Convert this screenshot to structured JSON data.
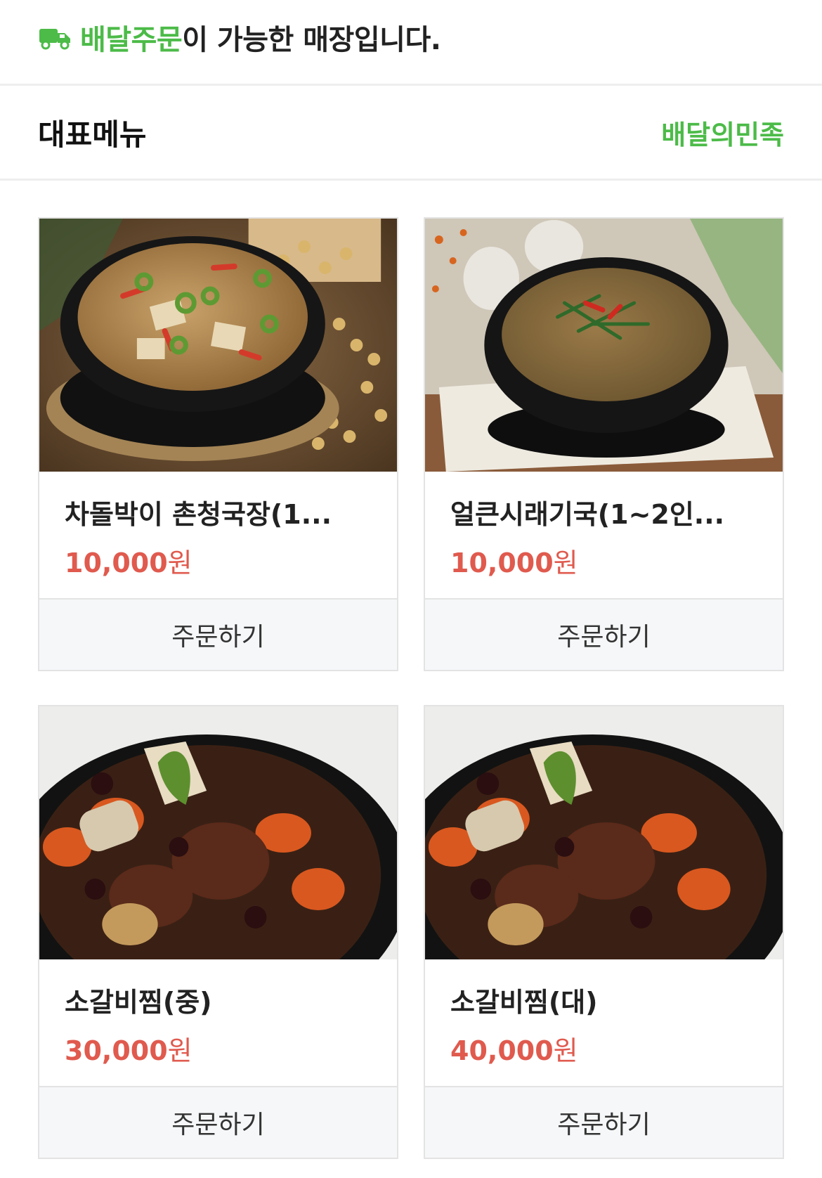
{
  "banner": {
    "highlight": "배달주문",
    "rest": "이 가능한 매장입니다.",
    "icon": "delivery-truck-icon",
    "accent": "#4cbb48"
  },
  "section": {
    "title": "대표메뉴",
    "link": "배달의민족"
  },
  "menu": {
    "order_label": "주문하기",
    "currency": "원",
    "price_color": "#e05a4e",
    "items": [
      {
        "name": "차돌박이 촌청국장(1...",
        "price": "10,000",
        "image": "soybean-paste-stew-photo"
      },
      {
        "name": "얼큰시래기국(1~2인...",
        "price": "10,000",
        "image": "radish-greens-soup-photo"
      },
      {
        "name": "소갈비찜(중)",
        "price": "30,000",
        "image": "braised-short-ribs-photo"
      },
      {
        "name": "소갈비찜(대)",
        "price": "40,000",
        "image": "braised-short-ribs-photo"
      }
    ]
  }
}
